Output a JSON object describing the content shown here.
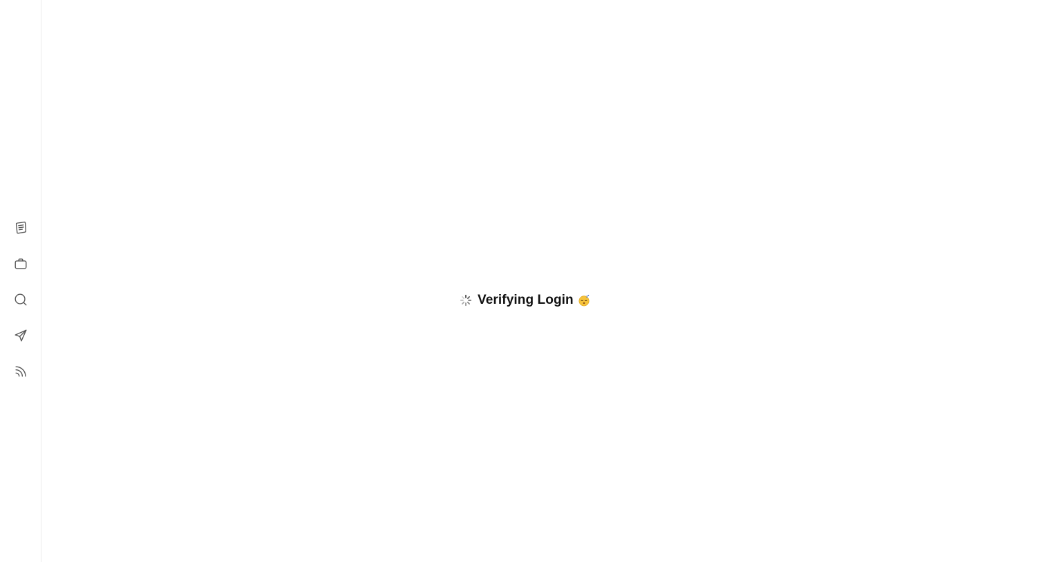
{
  "sidebar": {
    "items": [
      {
        "icon": "notes-icon",
        "name": "sidebar-item-notes"
      },
      {
        "icon": "briefcase-icon",
        "name": "sidebar-item-briefcase"
      },
      {
        "icon": "search-icon",
        "name": "sidebar-item-search"
      },
      {
        "icon": "send-icon",
        "name": "sidebar-item-send"
      },
      {
        "icon": "feed-icon",
        "name": "sidebar-item-feed"
      }
    ]
  },
  "main": {
    "loading_text": "Verifying Login",
    "emoji_icon": "sleeping-face-icon"
  },
  "colors": {
    "icon_stroke": "#555555",
    "text": "#111111",
    "border": "#ececec",
    "emoji_yellow": "#f6c33b"
  }
}
